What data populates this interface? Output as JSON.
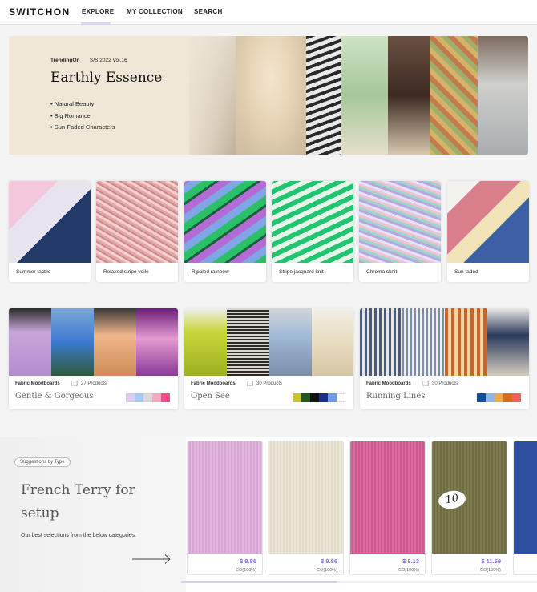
{
  "nav": {
    "logo": "SWITCHON",
    "links": [
      "EXPLORE",
      "MY COLLECTION",
      "SEARCH"
    ],
    "active": "EXPLORE"
  },
  "hero": {
    "tag": "TrendingOn",
    "season": "S/S 2022 Vol.16",
    "title": "Earthly Essence",
    "bullets": [
      "• Natural Beauty",
      "• Big Romance",
      "• Sun-Faded Characters"
    ]
  },
  "fabrics": [
    {
      "label": "Summer tactile"
    },
    {
      "label": "Relaxed stripe voile"
    },
    {
      "label": "Rippled rainbow"
    },
    {
      "label": "Stripe jacquard knit"
    },
    {
      "label": "Chroma sknit"
    },
    {
      "label": "Sun faded"
    }
  ],
  "moodboards": [
    {
      "type": "Fabric Moodboards",
      "count": "27 Products",
      "name": "Gentle & Gorgeous",
      "palette": [
        "#dccbf0",
        "#a9c9f2",
        "#d9d9db",
        "#f7a7c0",
        "#f04c8c"
      ]
    },
    {
      "type": "Fabric Moodboards",
      "count": "30 Products",
      "name": "Open See",
      "palette": [
        "#c9c42a",
        "#23561f",
        "#111111",
        "#1c2f86",
        "#6f9be6",
        "#ffffff"
      ]
    },
    {
      "type": "Fabric Moodboards",
      "count": "30 Products",
      "name": "Running Lines",
      "palette": [
        "#0f4c9c",
        "#8fb7e6",
        "#f0a84c",
        "#d86a1a",
        "#f06060"
      ]
    }
  ],
  "suggestions": {
    "pill": "Suggestions by Type",
    "title": "French Terry for setup",
    "description": "Our best selections from the below categories.",
    "products": [
      {
        "price": "$ 9.86",
        "composition": "CO(100%)"
      },
      {
        "price": "$ 9.86",
        "composition": "CO(100%)"
      },
      {
        "price": "$ 8.13",
        "composition": "CO(100%)"
      },
      {
        "price": "$ 11.59",
        "composition": "CO(100%)"
      }
    ],
    "tag_number": "10"
  },
  "colors": {
    "accent": "#7c6fd6",
    "hero_bg": "#f1e7d7"
  }
}
